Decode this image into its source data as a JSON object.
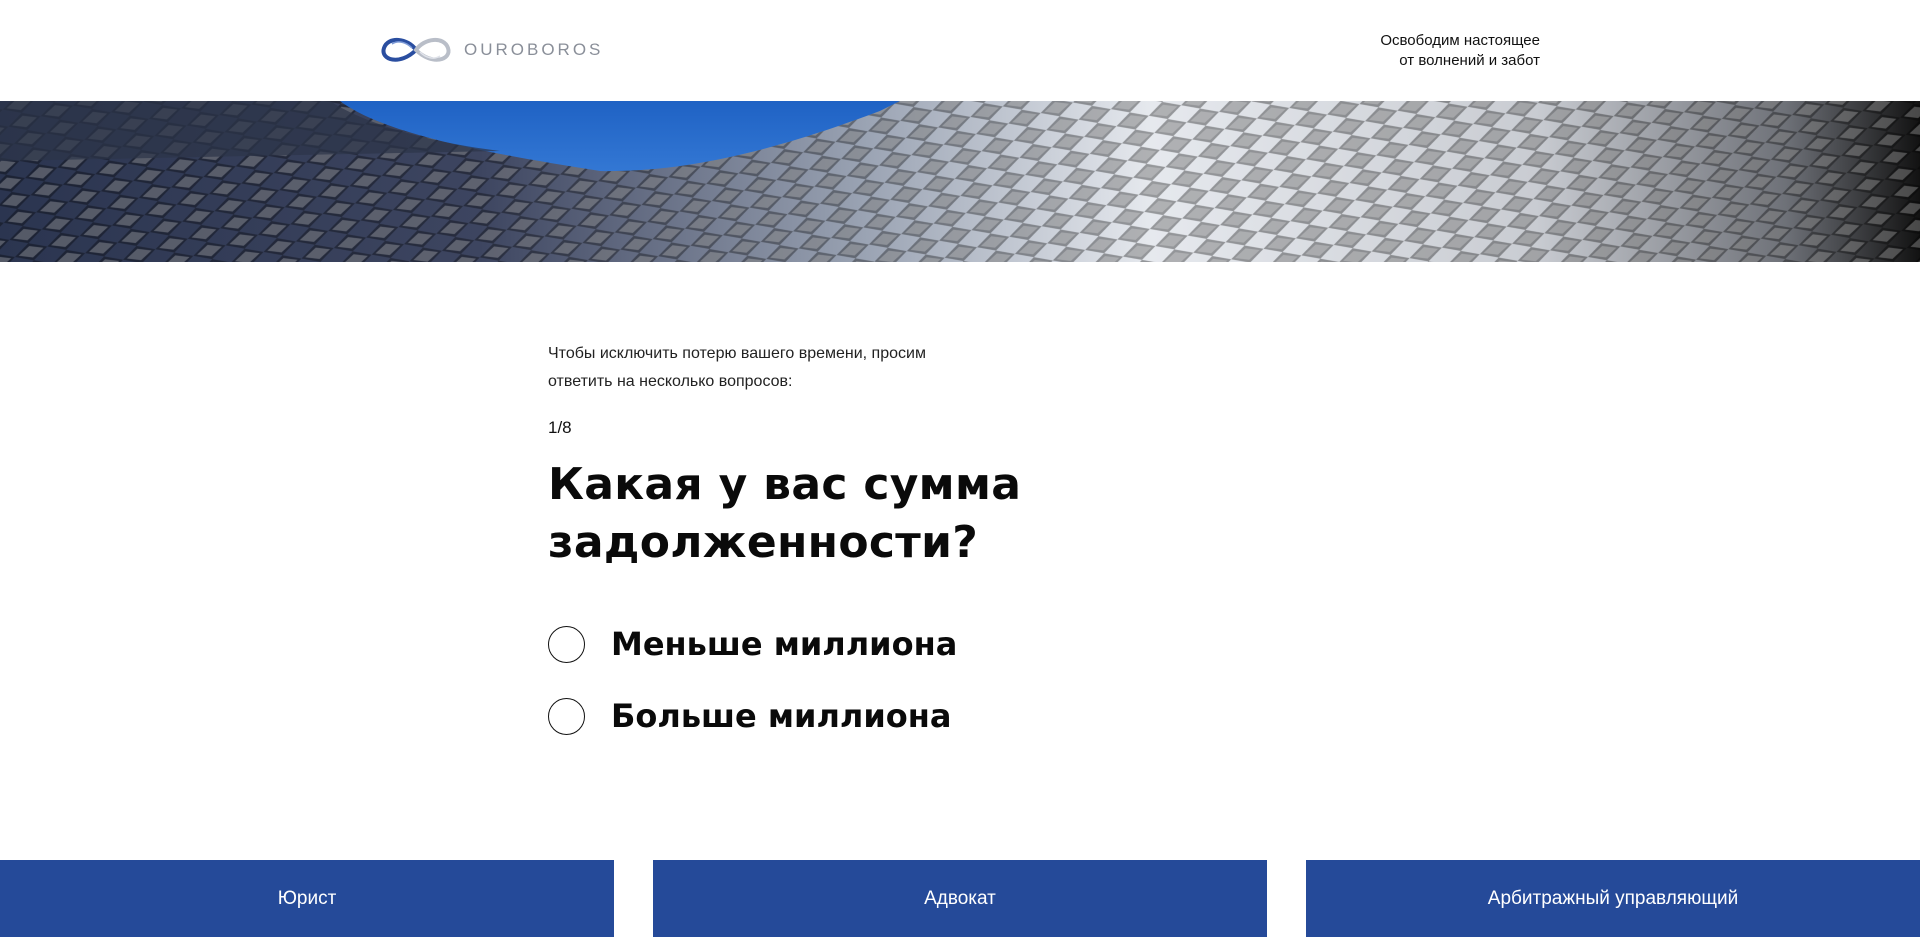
{
  "header": {
    "logo_text": "OUROBOROS",
    "logo_icon": "infinity-ouroboros-icon",
    "tagline_line1": "Освободим настоящее",
    "tagline_line2": "от волнений и забот"
  },
  "quiz": {
    "intro_line1": "Чтобы исключить потерю вашего времени, просим",
    "intro_line2": "ответить на несколько вопросов:",
    "step": "1/8",
    "question_line1": "Какая у вас сумма",
    "question_line2": "задолженности?",
    "options": [
      {
        "label": "Меньше миллиона",
        "selected": false
      },
      {
        "label": "Больше миллиона",
        "selected": false
      }
    ]
  },
  "footer": {
    "buttons": [
      "Юрист",
      "Адвокат",
      "Арбитражный управляющий"
    ],
    "color": "#254a99"
  },
  "colors": {
    "accent": "#254a99",
    "sky": "#2f74d0"
  }
}
